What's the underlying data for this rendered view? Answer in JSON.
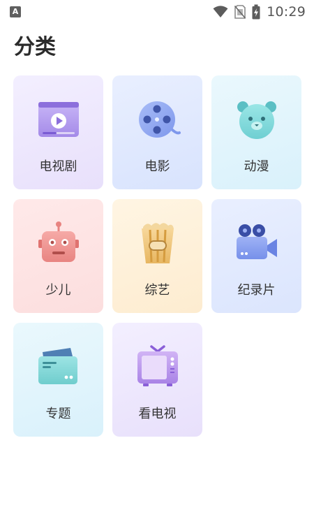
{
  "status_bar": {
    "notification_icon": "a-icon",
    "time": "10:29",
    "icons": [
      "wifi-icon",
      "no-sim-icon",
      "battery-charging-icon"
    ]
  },
  "page": {
    "title": "分类"
  },
  "categories": [
    {
      "label": "电视剧",
      "icon": "tv-series-icon",
      "color": "#b7a7ef"
    },
    {
      "label": "电影",
      "icon": "film-reel-icon",
      "color": "#8ea5ef"
    },
    {
      "label": "动漫",
      "icon": "bear-icon",
      "color": "#7fd8dc"
    },
    {
      "label": "少儿",
      "icon": "robot-icon",
      "color": "#f0908d"
    },
    {
      "label": "综艺",
      "icon": "popcorn-icon",
      "color": "#e9bf74"
    },
    {
      "label": "纪录片",
      "icon": "video-camera-icon",
      "color": "#7f98ec"
    },
    {
      "label": "专题",
      "icon": "folder-card-icon",
      "color": "#7ad6d6"
    },
    {
      "label": "看电视",
      "icon": "television-icon",
      "color": "#c29cec"
    }
  ]
}
